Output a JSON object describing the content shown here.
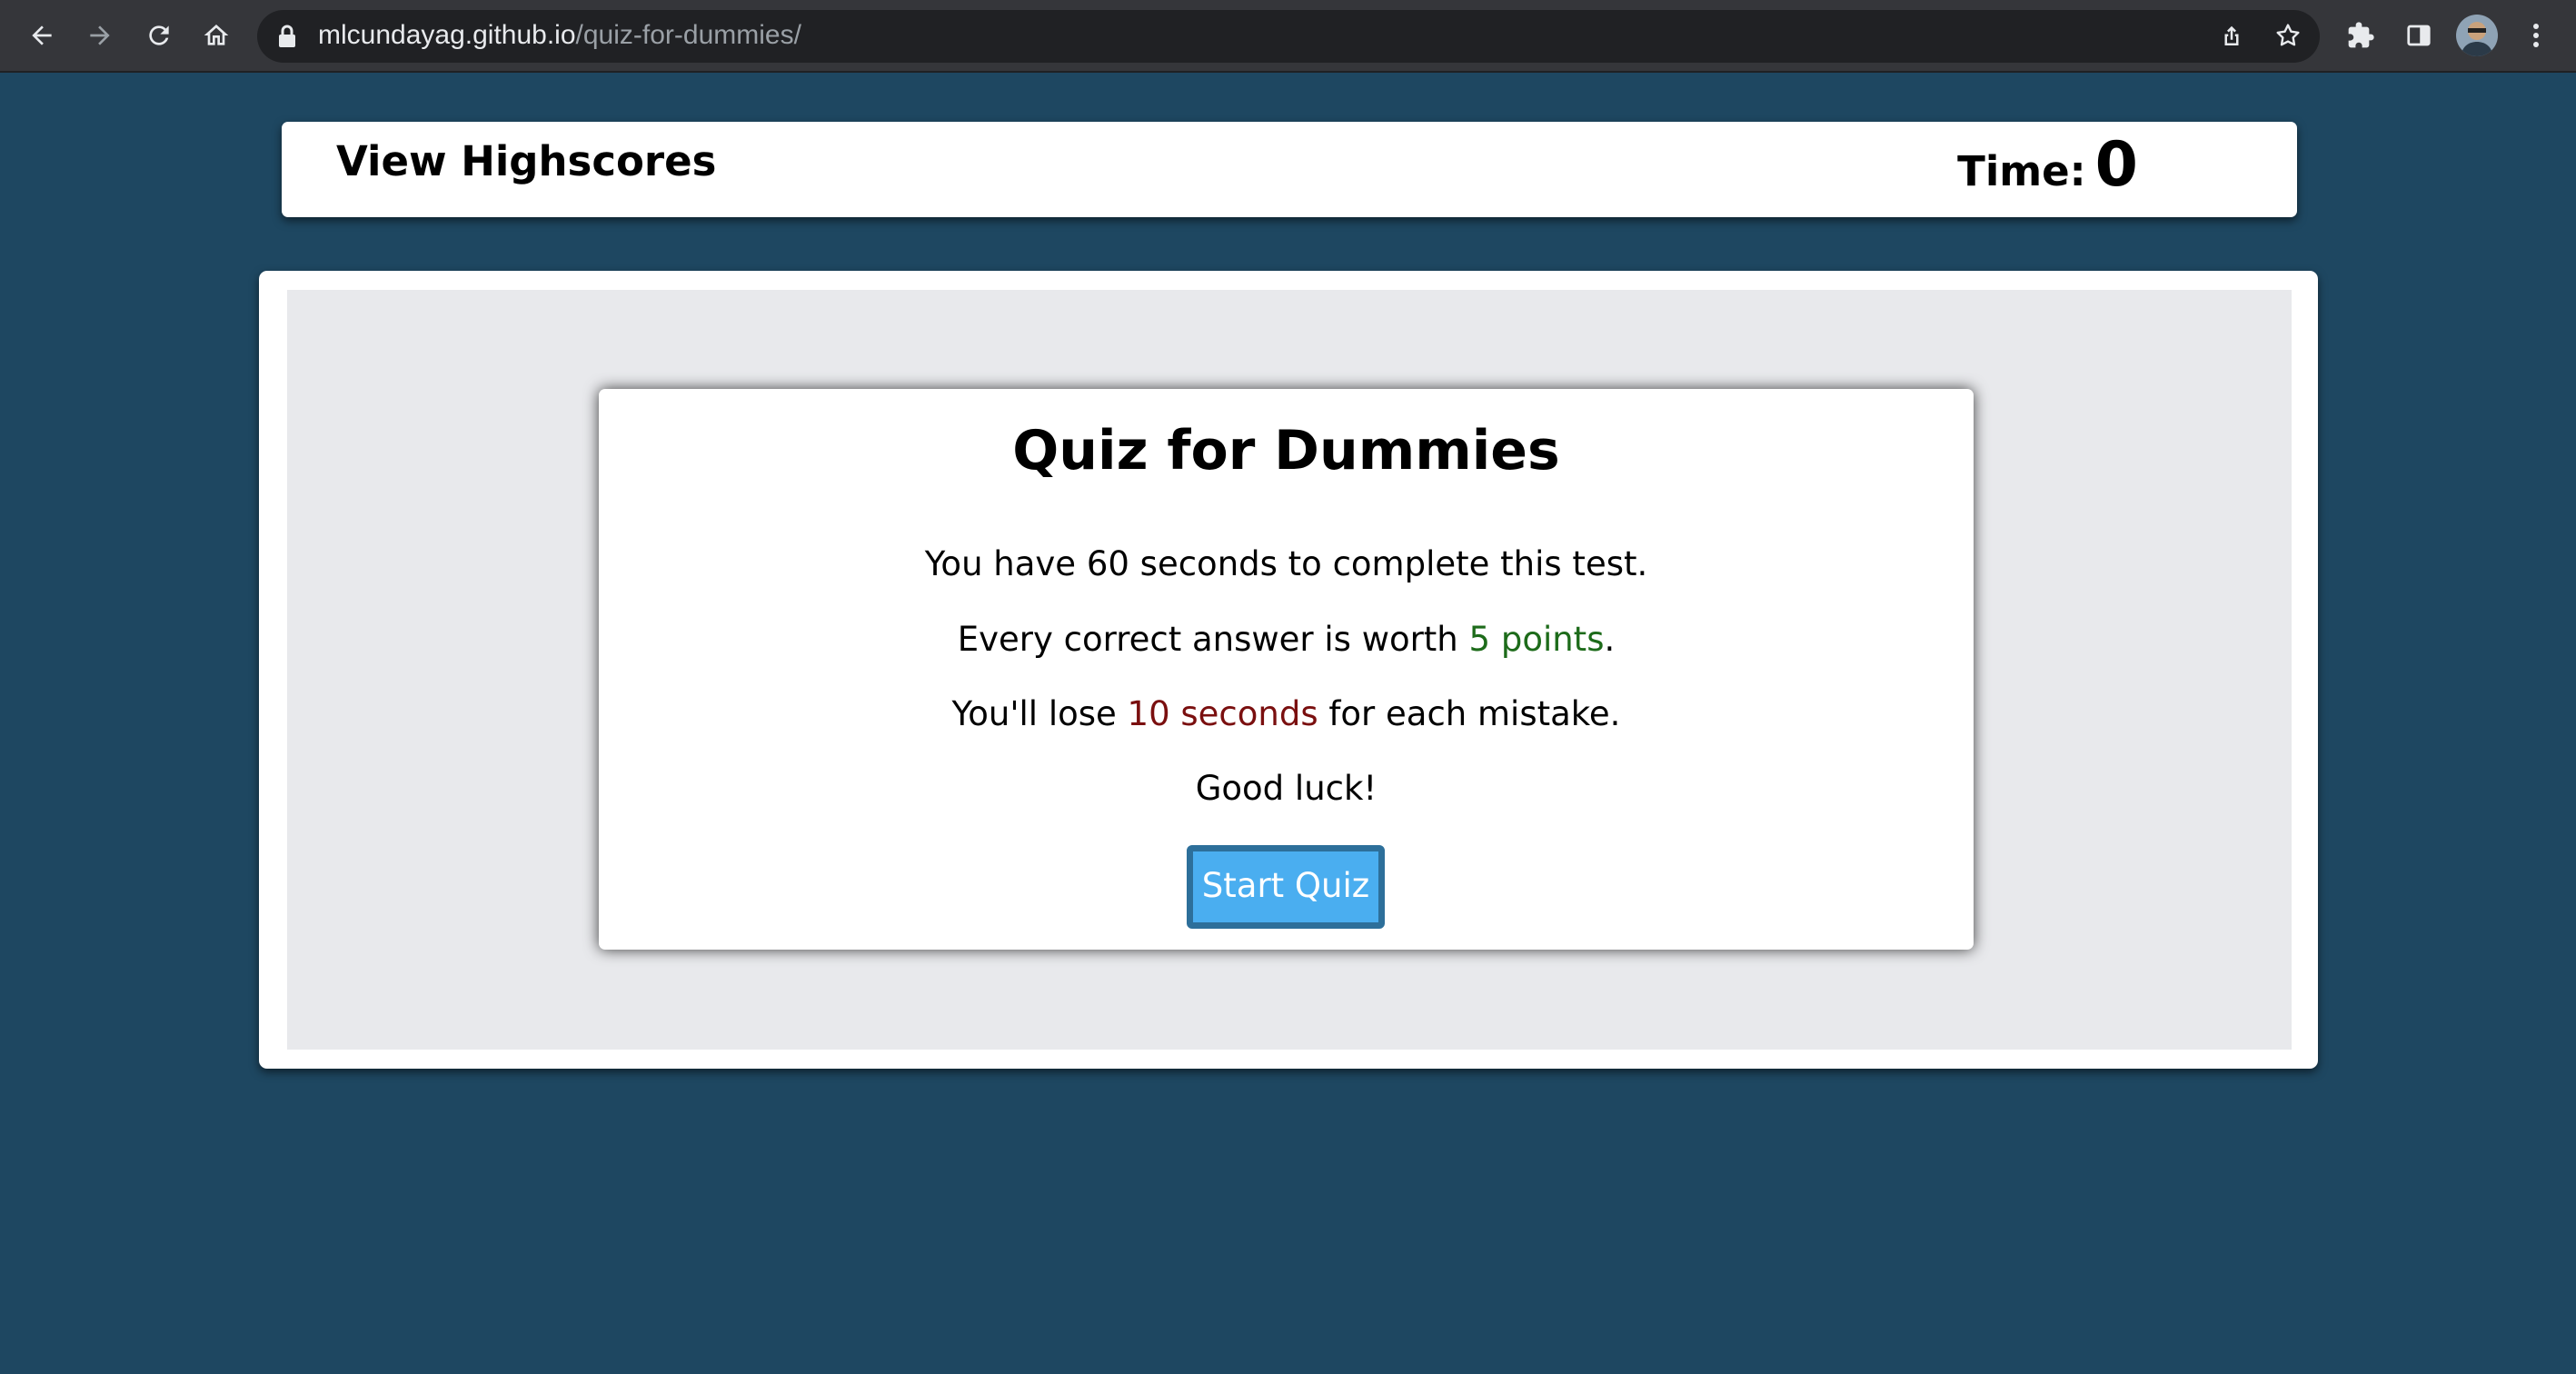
{
  "browser": {
    "url_domain": "mlcundayag.github.io",
    "url_path": "/quiz-for-dummies/"
  },
  "header": {
    "highscores_label": "View Highscores",
    "timer_label": "Time:",
    "timer_value": "0"
  },
  "quiz": {
    "title": "Quiz for Dummies",
    "line1": "You have 60 seconds to complete this test.",
    "line2_pre": "Every correct answer is worth ",
    "line2_highlight": "5 points",
    "line2_post": ".",
    "line3_pre": "You'll lose ",
    "line3_highlight": "10 seconds",
    "line3_post": " for each mistake.",
    "line4": "Good luck!",
    "start_button": "Start Quiz"
  },
  "colors": {
    "page_background": "#1e4761",
    "points_highlight": "#1d6b1a",
    "penalty_highlight": "#7a0f0f",
    "button_fill": "#4aaef0",
    "button_border": "#2d6f9a"
  },
  "icons": [
    "back-icon",
    "forward-icon",
    "reload-icon",
    "home-icon",
    "lock-icon",
    "share-icon",
    "star-icon",
    "extensions-icon",
    "side-panel-icon",
    "profile-avatar",
    "menu-icon"
  ]
}
